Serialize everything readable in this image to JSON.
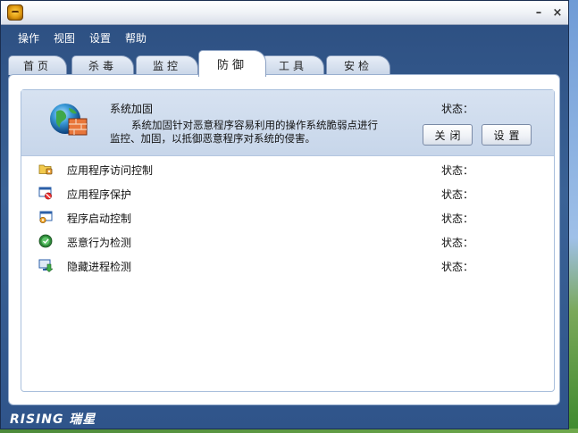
{
  "window": {
    "minimize_label": "–",
    "close_label": "×"
  },
  "menu": [
    "操作",
    "视图",
    "设置",
    "帮助"
  ],
  "tabs": [
    {
      "label": "首页",
      "active": false
    },
    {
      "label": "杀毒",
      "active": false
    },
    {
      "label": "监控",
      "active": false
    },
    {
      "label": "防御",
      "active": true
    },
    {
      "label": "工具",
      "active": false
    },
    {
      "label": "安检",
      "active": false
    }
  ],
  "feature": {
    "title": "系统加固",
    "description_line1": "系统加固针对恶意程序容易利用的操作系统脆弱点进行",
    "description_line2": "监控、加固，以抵御恶意程序对系统的侵害。",
    "status_label": "状态：",
    "close_button": "关闭",
    "settings_button": "设置",
    "icon": "globe-firewall-icon"
  },
  "items": [
    {
      "label": "应用程序访问控制",
      "status_label": "状态：",
      "icon": "folder-lock-icon"
    },
    {
      "label": "应用程序保护",
      "status_label": "状态：",
      "icon": "window-block-icon"
    },
    {
      "label": "程序启动控制",
      "status_label": "状态：",
      "icon": "window-gear-icon"
    },
    {
      "label": "恶意行为检测",
      "status_label": "状态：",
      "icon": "shield-check-icon"
    },
    {
      "label": "隐藏进程检测",
      "status_label": "状态：",
      "icon": "monitor-download-icon"
    }
  ],
  "brand": {
    "logo_text": "RISING 瑞星"
  },
  "colors": {
    "window_frame": "#3a6296",
    "feature_bg": "#c7d6ea",
    "tab_bg": "#c9d6e8"
  }
}
